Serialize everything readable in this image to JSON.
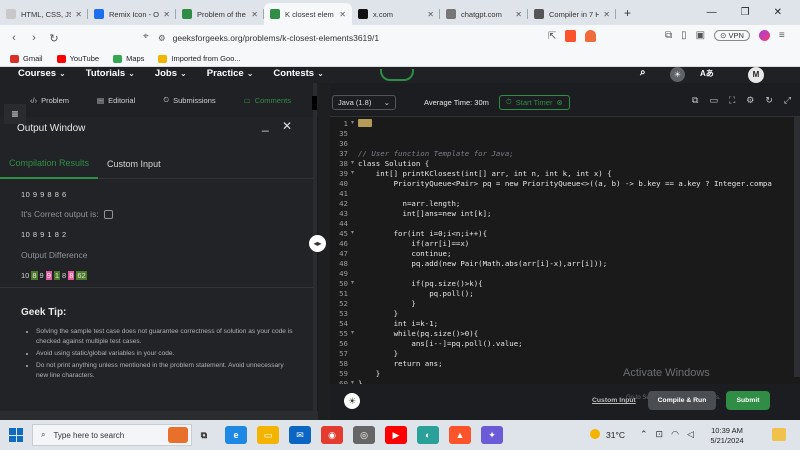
{
  "browser": {
    "tabs": [
      {
        "label": "HTML, CSS, JS - Re",
        "fav_color": "#c8c8c8"
      },
      {
        "label": "Remix Icon - Open",
        "fav_color": "#1e6ff0"
      },
      {
        "label": "Problem of the Da",
        "fav_color": "#2f8d46"
      },
      {
        "label": "K closest elem",
        "fav_color": "#2f8d46",
        "active": true
      },
      {
        "label": "x.com",
        "fav_color": "#111"
      },
      {
        "label": "chatgpt.com",
        "fav_color": "#777"
      },
      {
        "label": "Compiler in 7 Hou",
        "fav_color": "#555"
      }
    ],
    "url": "geeksforgeeks.org/problems/k-closest-elements3619/1",
    "vpn_label": "VPN",
    "bookmarks": [
      {
        "label": "Gmail",
        "color": "#d93025"
      },
      {
        "label": "YouTube",
        "color": "#ff0000"
      },
      {
        "label": "Maps",
        "color": "#34a853"
      },
      {
        "label": "Imported from Goo...",
        "color": "#f3b400"
      }
    ]
  },
  "gfg_nav": {
    "items": [
      "Courses",
      "Tutorials",
      "Jobs",
      "Practice",
      "Contests"
    ],
    "avatar": "M",
    "brand_color": "#2f8d46"
  },
  "left_tabs": [
    "Problem",
    "Editorial",
    "Submissions",
    "Comments"
  ],
  "output_window": {
    "title": "Output Window",
    "tabs": [
      "Compilation Results",
      "Custom Input"
    ],
    "your_output": "10 9 9 8 8 6",
    "correct_label": "It's Correct output is:",
    "correct_output": "10 8 9 1 8 2",
    "difference_label": "Output Difference",
    "diff": [
      {
        "text": "10",
        "type": "same"
      },
      {
        "text": "8",
        "type": "del"
      },
      {
        "text": "9",
        "type": "same"
      },
      {
        "text": "9",
        "type": "ins"
      },
      {
        "text": "1",
        "type": "del"
      },
      {
        "text": "8",
        "type": "same"
      },
      {
        "text": "8",
        "type": "ins"
      },
      {
        "text": "62",
        "type": "del"
      }
    ]
  },
  "geek_tip": {
    "title": "Geek Tip:",
    "items": [
      "Solving the sample test case does not guarantee correctness of solution as your code is checked against multiple test cases.",
      "Avoid using static/global variables in your code.",
      "Do not print anything unless mentioned in the problem statement. Avoid unnecessary new line characters."
    ]
  },
  "editor": {
    "language": "Java (1.8)",
    "avg_time_label": "Average Time: 30m",
    "timer_label": "Start Timer",
    "lines": [
      {
        "n": "1",
        "text": "",
        "fold": true
      },
      {
        "n": "35",
        "text": ""
      },
      {
        "n": "36",
        "text": ""
      },
      {
        "n": "37",
        "text": "// User function Template for Java;",
        "comment": true
      },
      {
        "n": "38",
        "text": "class Solution {",
        "fold": true
      },
      {
        "n": "39",
        "text": "    int[] printKClosest(int[] arr, int n, int k, int x) {",
        "fold": true
      },
      {
        "n": "40",
        "text": "        PriorityQueue<Pair> pq = new PriorityQueue<>((a, b) -> b.key == a.key ? Integer.compa"
      },
      {
        "n": "41",
        "text": ""
      },
      {
        "n": "42",
        "text": "          n=arr.length;"
      },
      {
        "n": "43",
        "text": "          int[]ans=new int[k];"
      },
      {
        "n": "44",
        "text": ""
      },
      {
        "n": "45",
        "text": "        for(int i=0;i<n;i++){",
        "fold": true
      },
      {
        "n": "46",
        "text": "            if(arr[i]==x)"
      },
      {
        "n": "47",
        "text": "            continue;"
      },
      {
        "n": "48",
        "text": "            pq.add(new Pair(Math.abs(arr[i]-x),arr[i]));"
      },
      {
        "n": "49",
        "text": ""
      },
      {
        "n": "50",
        "text": "            if(pq.size()>k){",
        "fold": true
      },
      {
        "n": "51",
        "text": "                pq.poll();"
      },
      {
        "n": "52",
        "text": "            }"
      },
      {
        "n": "53",
        "text": "        }"
      },
      {
        "n": "54",
        "text": "        int i=k-1;"
      },
      {
        "n": "55",
        "text": "        while(pq.size()>0){",
        "fold": true
      },
      {
        "n": "56",
        "text": "            ans[i--]=pq.poll().value;"
      },
      {
        "n": "57",
        "text": "        }"
      },
      {
        "n": "58",
        "text": "        return ans;"
      },
      {
        "n": "59",
        "text": "    }"
      },
      {
        "n": "60",
        "text": "}",
        "fold": true
      }
    ],
    "custom_input_label": "Custom Input",
    "compile_label": "Compile & Run",
    "submit_label": "Submit",
    "watermark": "Activate Windows",
    "watermark_sub": "Go to Settings to activate Windows."
  },
  "taskbar": {
    "search_placeholder": "Type here to search",
    "temperature": "31°C",
    "time": "10:39 AM",
    "date": "5/21/2024",
    "lang": "ENG"
  }
}
